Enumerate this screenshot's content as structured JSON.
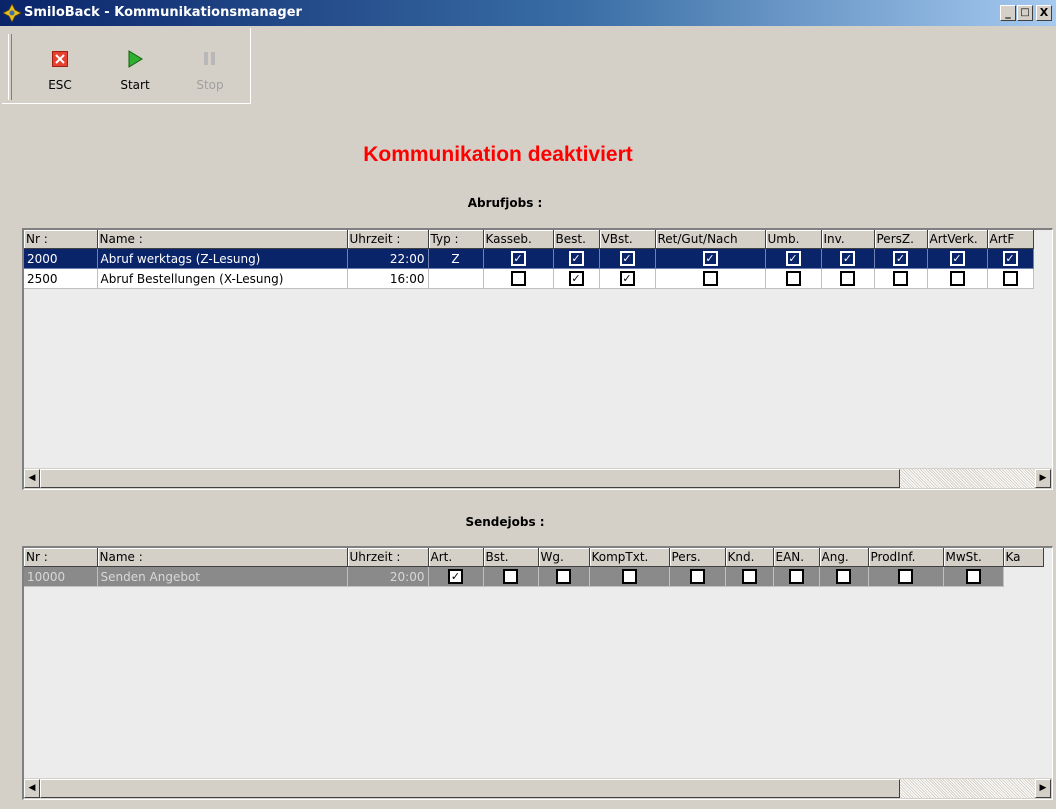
{
  "window": {
    "title": "SmiloBack - Kommunikationsmanager",
    "controls": {
      "minimize": "_",
      "maximize": "□",
      "close": "X"
    }
  },
  "toolbar": {
    "esc": {
      "label": "ESC",
      "icon": "esc-icon"
    },
    "start": {
      "label": "Start",
      "icon": "play-icon"
    },
    "stop": {
      "label": "Stop",
      "icon": "pause-icon",
      "enabled": false
    }
  },
  "status": {
    "text": "Kommunikation deaktiviert",
    "color": "#ff0000"
  },
  "abrufjobs": {
    "title": "Abrufjobs :",
    "columns": [
      "Nr :",
      "Name :",
      "Uhrzeit :",
      "Typ :",
      "Kasseb.",
      "Best.",
      "VBst.",
      "Ret/Gut/Nach",
      "Umb.",
      "Inv.",
      "PersZ.",
      "ArtVerk.",
      "ArtF"
    ],
    "rows": [
      {
        "nr": "2000",
        "name": "Abruf werktags (Z-Lesung)",
        "time": "22:00",
        "typ": "Z",
        "checks": [
          true,
          true,
          true,
          true,
          true,
          true,
          true,
          true,
          true
        ],
        "selected": true
      },
      {
        "nr": "2500",
        "name": "Abruf Bestellungen (X-Lesung)",
        "time": "16:00",
        "typ": "",
        "checks": [
          false,
          true,
          true,
          false,
          false,
          false,
          false,
          false,
          false
        ],
        "selected": false
      }
    ]
  },
  "sendejobs": {
    "title": "Sendejobs :",
    "columns": [
      "Nr :",
      "Name :",
      "Uhrzeit :",
      "Art.",
      "Bst.",
      "Wg.",
      "KompTxt.",
      "Pers.",
      "Knd.",
      "EAN.",
      "Ang.",
      "ProdInf.",
      "MwSt.",
      "Ka"
    ],
    "rows": [
      {
        "nr": "10000",
        "name": "Senden Angebot",
        "time": "20:00",
        "checks": [
          true,
          false,
          false,
          false,
          false,
          false,
          false,
          false,
          false,
          false
        ],
        "selected": true
      }
    ]
  },
  "colors": {
    "titlebar": "#0a246a",
    "selection": "#0a246a",
    "inactive_selection": "#8a8a8a"
  }
}
